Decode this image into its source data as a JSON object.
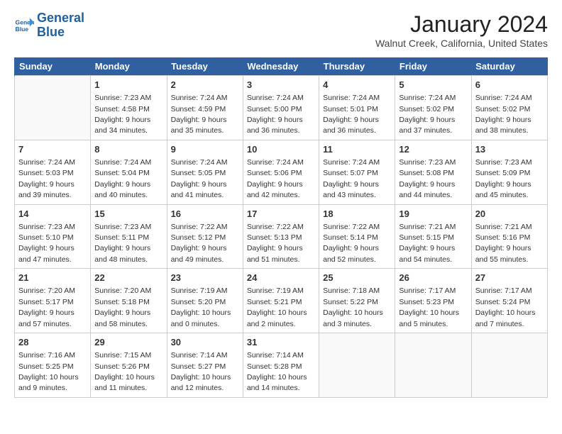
{
  "header": {
    "logo_line1": "General",
    "logo_line2": "Blue",
    "title": "January 2024",
    "subtitle": "Walnut Creek, California, United States"
  },
  "days_of_week": [
    "Sunday",
    "Monday",
    "Tuesday",
    "Wednesday",
    "Thursday",
    "Friday",
    "Saturday"
  ],
  "weeks": [
    [
      {
        "day": null
      },
      {
        "day": "1",
        "sunrise": "7:23 AM",
        "sunset": "4:58 PM",
        "daylight": "9 hours and 34 minutes."
      },
      {
        "day": "2",
        "sunrise": "7:24 AM",
        "sunset": "4:59 PM",
        "daylight": "9 hours and 35 minutes."
      },
      {
        "day": "3",
        "sunrise": "7:24 AM",
        "sunset": "5:00 PM",
        "daylight": "9 hours and 36 minutes."
      },
      {
        "day": "4",
        "sunrise": "7:24 AM",
        "sunset": "5:01 PM",
        "daylight": "9 hours and 36 minutes."
      },
      {
        "day": "5",
        "sunrise": "7:24 AM",
        "sunset": "5:02 PM",
        "daylight": "9 hours and 37 minutes."
      },
      {
        "day": "6",
        "sunrise": "7:24 AM",
        "sunset": "5:02 PM",
        "daylight": "9 hours and 38 minutes."
      }
    ],
    [
      {
        "day": "7",
        "sunrise": "7:24 AM",
        "sunset": "5:03 PM",
        "daylight": "9 hours and 39 minutes."
      },
      {
        "day": "8",
        "sunrise": "7:24 AM",
        "sunset": "5:04 PM",
        "daylight": "9 hours and 40 minutes."
      },
      {
        "day": "9",
        "sunrise": "7:24 AM",
        "sunset": "5:05 PM",
        "daylight": "9 hours and 41 minutes."
      },
      {
        "day": "10",
        "sunrise": "7:24 AM",
        "sunset": "5:06 PM",
        "daylight": "9 hours and 42 minutes."
      },
      {
        "day": "11",
        "sunrise": "7:24 AM",
        "sunset": "5:07 PM",
        "daylight": "9 hours and 43 minutes."
      },
      {
        "day": "12",
        "sunrise": "7:23 AM",
        "sunset": "5:08 PM",
        "daylight": "9 hours and 44 minutes."
      },
      {
        "day": "13",
        "sunrise": "7:23 AM",
        "sunset": "5:09 PM",
        "daylight": "9 hours and 45 minutes."
      }
    ],
    [
      {
        "day": "14",
        "sunrise": "7:23 AM",
        "sunset": "5:10 PM",
        "daylight": "9 hours and 47 minutes."
      },
      {
        "day": "15",
        "sunrise": "7:23 AM",
        "sunset": "5:11 PM",
        "daylight": "9 hours and 48 minutes."
      },
      {
        "day": "16",
        "sunrise": "7:22 AM",
        "sunset": "5:12 PM",
        "daylight": "9 hours and 49 minutes."
      },
      {
        "day": "17",
        "sunrise": "7:22 AM",
        "sunset": "5:13 PM",
        "daylight": "9 hours and 51 minutes."
      },
      {
        "day": "18",
        "sunrise": "7:22 AM",
        "sunset": "5:14 PM",
        "daylight": "9 hours and 52 minutes."
      },
      {
        "day": "19",
        "sunrise": "7:21 AM",
        "sunset": "5:15 PM",
        "daylight": "9 hours and 54 minutes."
      },
      {
        "day": "20",
        "sunrise": "7:21 AM",
        "sunset": "5:16 PM",
        "daylight": "9 hours and 55 minutes."
      }
    ],
    [
      {
        "day": "21",
        "sunrise": "7:20 AM",
        "sunset": "5:17 PM",
        "daylight": "9 hours and 57 minutes."
      },
      {
        "day": "22",
        "sunrise": "7:20 AM",
        "sunset": "5:18 PM",
        "daylight": "9 hours and 58 minutes."
      },
      {
        "day": "23",
        "sunrise": "7:19 AM",
        "sunset": "5:20 PM",
        "daylight": "10 hours and 0 minutes."
      },
      {
        "day": "24",
        "sunrise": "7:19 AM",
        "sunset": "5:21 PM",
        "daylight": "10 hours and 2 minutes."
      },
      {
        "day": "25",
        "sunrise": "7:18 AM",
        "sunset": "5:22 PM",
        "daylight": "10 hours and 3 minutes."
      },
      {
        "day": "26",
        "sunrise": "7:17 AM",
        "sunset": "5:23 PM",
        "daylight": "10 hours and 5 minutes."
      },
      {
        "day": "27",
        "sunrise": "7:17 AM",
        "sunset": "5:24 PM",
        "daylight": "10 hours and 7 minutes."
      }
    ],
    [
      {
        "day": "28",
        "sunrise": "7:16 AM",
        "sunset": "5:25 PM",
        "daylight": "10 hours and 9 minutes."
      },
      {
        "day": "29",
        "sunrise": "7:15 AM",
        "sunset": "5:26 PM",
        "daylight": "10 hours and 11 minutes."
      },
      {
        "day": "30",
        "sunrise": "7:14 AM",
        "sunset": "5:27 PM",
        "daylight": "10 hours and 12 minutes."
      },
      {
        "day": "31",
        "sunrise": "7:14 AM",
        "sunset": "5:28 PM",
        "daylight": "10 hours and 14 minutes."
      },
      {
        "day": null
      },
      {
        "day": null
      },
      {
        "day": null
      }
    ]
  ]
}
